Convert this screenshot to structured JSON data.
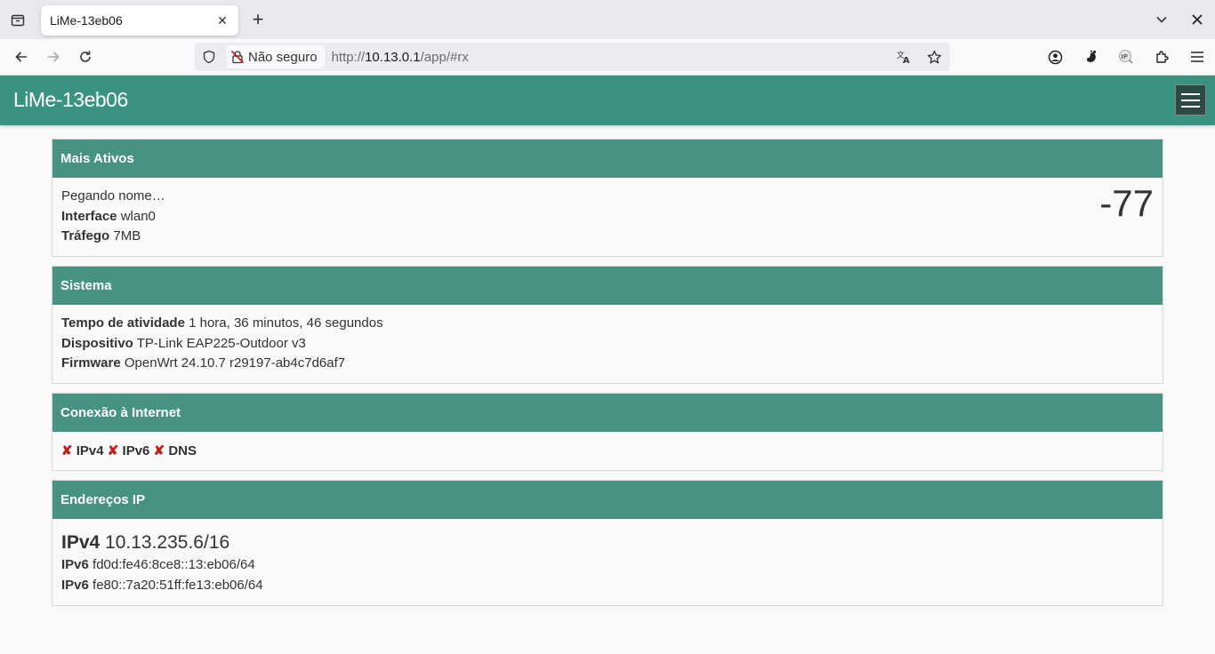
{
  "browser": {
    "tab_title": "LiMe-13eb06",
    "security_label": "Não seguro",
    "url_prefix": "http://",
    "url_host": "10.13.0.1",
    "url_path": "/app/#rx"
  },
  "app": {
    "title": "LiMe-13eb06"
  },
  "mais_ativos": {
    "header": "Mais Ativos",
    "name_line": "Pegando nome…",
    "interface_label": "Interface",
    "interface_value": "wlan0",
    "traffic_label": "Tráfego",
    "traffic_value": "7MB",
    "signal": "-77"
  },
  "sistema": {
    "header": "Sistema",
    "uptime_label": "Tempo de atividade",
    "uptime_value": "1 hora, 36 minutos, 46 segundos",
    "device_label": "Dispositivo",
    "device_value": "TP-Link EAP225-Outdoor v3",
    "firmware_label": "Firmware",
    "firmware_value": "OpenWrt 24.10.7 r29197-ab4c7d6af7"
  },
  "conexao": {
    "header": "Conexão à Internet",
    "mark": "✘",
    "items": [
      "IPv4",
      "IPv6",
      "DNS"
    ]
  },
  "enderecos": {
    "header": "Endereços IP",
    "ipv4_label": "IPv4",
    "ipv4_value": "10.13.235.6/16",
    "ipv6_label": "IPv6",
    "ipv6_a": "fd0d:fe46:8ce8::13:eb06/64",
    "ipv6_b": "fe80::7a20:51ff:fe13:eb06/64"
  },
  "colors": {
    "header_bg": "#3a9380",
    "card_head_bg": "#479383",
    "fail_mark": "#c0201a"
  }
}
